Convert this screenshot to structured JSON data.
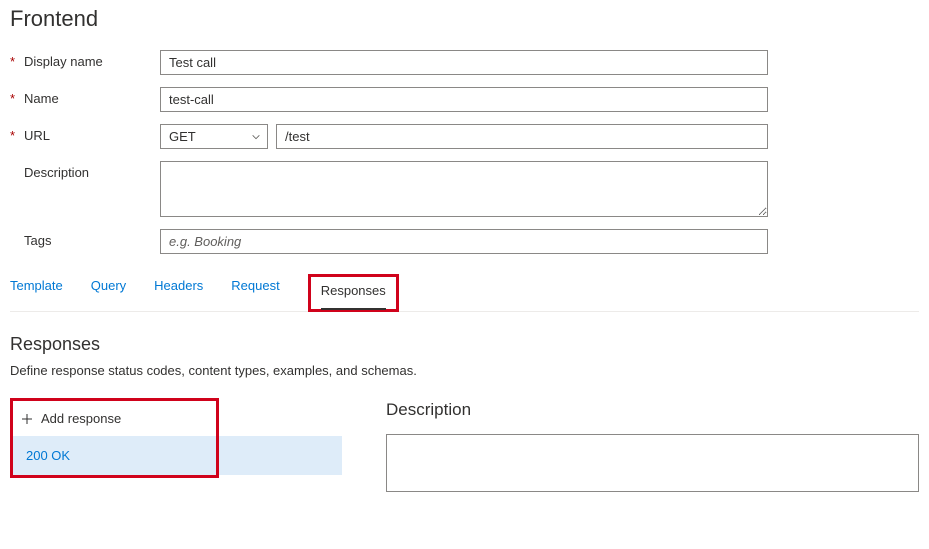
{
  "page_title": "Frontend",
  "form": {
    "display_name": {
      "label": "Display name",
      "value": "Test call",
      "required": true
    },
    "name": {
      "label": "Name",
      "value": "test-call",
      "required": true
    },
    "url": {
      "label": "URL",
      "method": "GET",
      "path": "/test",
      "required": true
    },
    "description": {
      "label": "Description",
      "value": ""
    },
    "tags": {
      "label": "Tags",
      "value": "",
      "placeholder": "e.g. Booking"
    }
  },
  "tabs": {
    "template": "Template",
    "query": "Query",
    "headers": "Headers",
    "request": "Request",
    "responses": "Responses",
    "active": "responses"
  },
  "responses_section": {
    "title": "Responses",
    "subtitle": "Define response status codes, content types, examples, and schemas.",
    "add_label": "Add response",
    "items": [
      {
        "label": "200 OK",
        "selected": true
      }
    ],
    "detail": {
      "description_label": "Description",
      "description_value": ""
    }
  }
}
